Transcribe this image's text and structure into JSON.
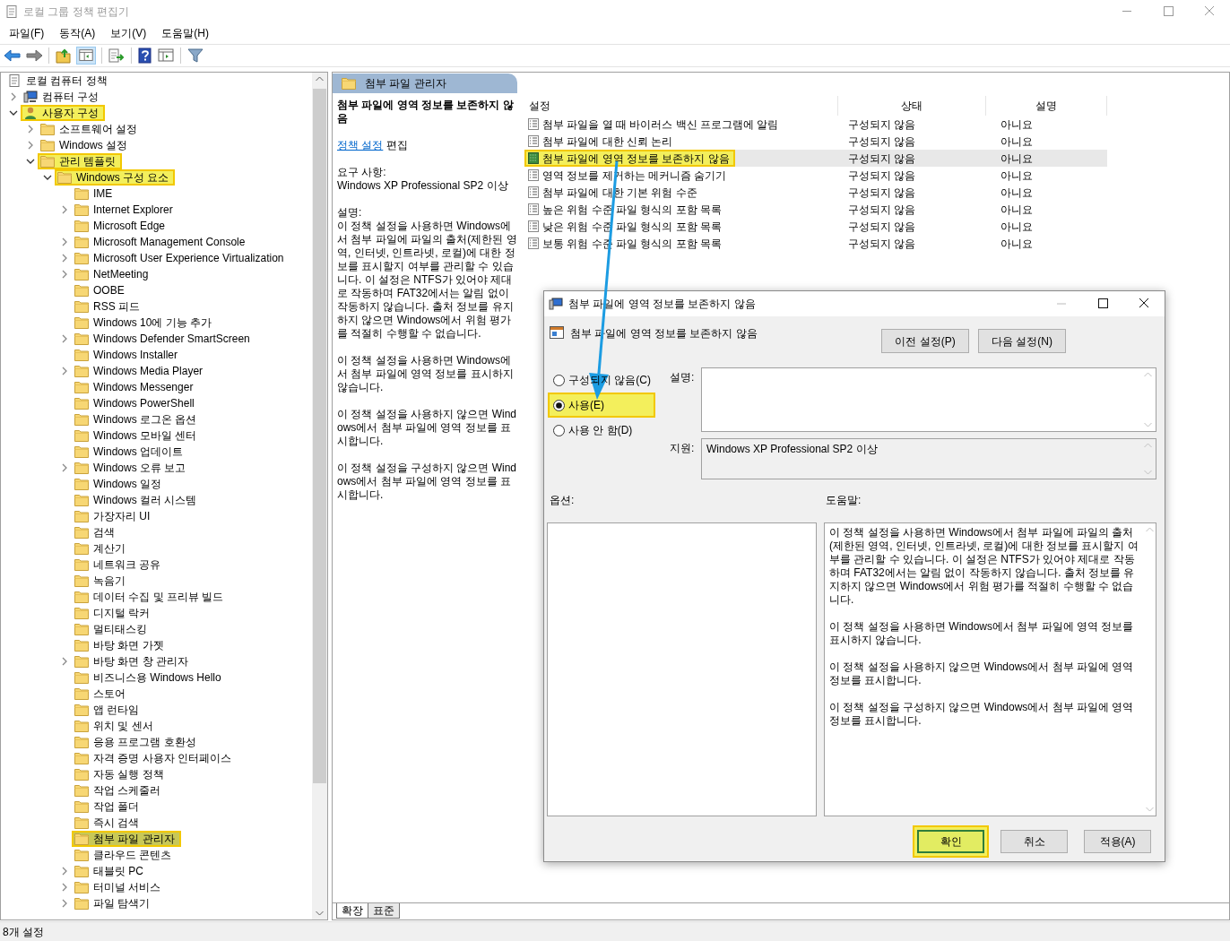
{
  "window": {
    "title": "로컬 그룹 정책 편집기",
    "active": false
  },
  "menu": [
    "파일(F)",
    "동작(A)",
    "보기(V)",
    "도움말(H)"
  ],
  "tree": {
    "root": {
      "label": "로컬 컴퓨터 정책",
      "kind": "policy",
      "selected": false,
      "highlighted": false,
      "children": [
        {
          "label": "컴퓨터 구성",
          "kind": "computer",
          "expanded": false,
          "selected": false,
          "highlighted": false
        },
        {
          "label": "사용자 구성",
          "kind": "user",
          "expanded": true,
          "selected": false,
          "highlighted": true,
          "children": [
            {
              "label": "소프트웨어 설정",
              "kind": "folder",
              "expanded": false,
              "selected": false,
              "highlighted": false
            },
            {
              "label": "Windows 설정",
              "kind": "folder",
              "expanded": false,
              "selected": false,
              "highlighted": false
            },
            {
              "label": "관리 템플릿",
              "kind": "folder",
              "expanded": true,
              "selected": false,
              "highlighted": true,
              "children": [
                {
                  "label": "Windows 구성 요소",
                  "kind": "folder",
                  "expanded": true,
                  "selected": false,
                  "highlighted": true,
                  "children": [
                    {
                      "label": "IME",
                      "kind": "folder",
                      "selected": false,
                      "highlighted": false
                    },
                    {
                      "label": "Internet Explorer",
                      "kind": "folder",
                      "expanded": false,
                      "selected": false,
                      "highlighted": false
                    },
                    {
                      "label": "Microsoft Edge",
                      "kind": "folder",
                      "selected": false,
                      "highlighted": false
                    },
                    {
                      "label": "Microsoft Management Console",
                      "kind": "folder",
                      "expanded": false,
                      "selected": false,
                      "highlighted": false
                    },
                    {
                      "label": "Microsoft User Experience Virtualization",
                      "kind": "folder",
                      "expanded": false,
                      "selected": false,
                      "highlighted": false
                    },
                    {
                      "label": "NetMeeting",
                      "kind": "folder",
                      "expanded": false,
                      "selected": false,
                      "highlighted": false
                    },
                    {
                      "label": "OOBE",
                      "kind": "folder",
                      "selected": false,
                      "highlighted": false
                    },
                    {
                      "label": "RSS 피드",
                      "kind": "folder",
                      "selected": false,
                      "highlighted": false
                    },
                    {
                      "label": "Windows 10에 기능 추가",
                      "kind": "folder",
                      "selected": false,
                      "highlighted": false
                    },
                    {
                      "label": "Windows Defender SmartScreen",
                      "kind": "folder",
                      "expanded": false,
                      "selected": false,
                      "highlighted": false
                    },
                    {
                      "label": "Windows Installer",
                      "kind": "folder",
                      "selected": false,
                      "highlighted": false
                    },
                    {
                      "label": "Windows Media Player",
                      "kind": "folder",
                      "expanded": false,
                      "selected": false,
                      "highlighted": false
                    },
                    {
                      "label": "Windows Messenger",
                      "kind": "folder",
                      "selected": false,
                      "highlighted": false
                    },
                    {
                      "label": "Windows PowerShell",
                      "kind": "folder",
                      "selected": false,
                      "highlighted": false
                    },
                    {
                      "label": "Windows 로그온 옵션",
                      "kind": "folder",
                      "selected": false,
                      "highlighted": false
                    },
                    {
                      "label": "Windows 모바일 센터",
                      "kind": "folder",
                      "selected": false,
                      "highlighted": false
                    },
                    {
                      "label": "Windows 업데이트",
                      "kind": "folder",
                      "selected": false,
                      "highlighted": false
                    },
                    {
                      "label": "Windows 오류 보고",
                      "kind": "folder",
                      "expanded": false,
                      "selected": false,
                      "highlighted": false
                    },
                    {
                      "label": "Windows 일정",
                      "kind": "folder",
                      "selected": false,
                      "highlighted": false
                    },
                    {
                      "label": "Windows 컬러 시스템",
                      "kind": "folder",
                      "selected": false,
                      "highlighted": false
                    },
                    {
                      "label": "가장자리 UI",
                      "kind": "folder",
                      "selected": false,
                      "highlighted": false
                    },
                    {
                      "label": "검색",
                      "kind": "folder",
                      "selected": false,
                      "highlighted": false
                    },
                    {
                      "label": "계산기",
                      "kind": "folder",
                      "selected": false,
                      "highlighted": false
                    },
                    {
                      "label": "네트워크 공유",
                      "kind": "folder",
                      "selected": false,
                      "highlighted": false
                    },
                    {
                      "label": "녹음기",
                      "kind": "folder",
                      "selected": false,
                      "highlighted": false
                    },
                    {
                      "label": "데이터 수집 및 프리뷰 빌드",
                      "kind": "folder",
                      "selected": false,
                      "highlighted": false
                    },
                    {
                      "label": "디지털 락커",
                      "kind": "folder",
                      "selected": false,
                      "highlighted": false
                    },
                    {
                      "label": "멀티태스킹",
                      "kind": "folder",
                      "selected": false,
                      "highlighted": false
                    },
                    {
                      "label": "바탕 화면 가젯",
                      "kind": "folder",
                      "selected": false,
                      "highlighted": false
                    },
                    {
                      "label": "바탕 화면 창 관리자",
                      "kind": "folder",
                      "expanded": false,
                      "selected": false,
                      "highlighted": false
                    },
                    {
                      "label": "비즈니스용 Windows Hello",
                      "kind": "folder",
                      "selected": false,
                      "highlighted": false
                    },
                    {
                      "label": "스토어",
                      "kind": "folder",
                      "selected": false,
                      "highlighted": false
                    },
                    {
                      "label": "앱 런타임",
                      "kind": "folder",
                      "selected": false,
                      "highlighted": false
                    },
                    {
                      "label": "위치 및 센서",
                      "kind": "folder",
                      "selected": false,
                      "highlighted": false
                    },
                    {
                      "label": "응용 프로그램 호환성",
                      "kind": "folder",
                      "selected": false,
                      "highlighted": false
                    },
                    {
                      "label": "자격 증명 사용자 인터페이스",
                      "kind": "folder",
                      "selected": false,
                      "highlighted": false
                    },
                    {
                      "label": "자동 실행 정책",
                      "kind": "folder",
                      "selected": false,
                      "highlighted": false
                    },
                    {
                      "label": "작업 스케줄러",
                      "kind": "folder",
                      "selected": false,
                      "highlighted": false
                    },
                    {
                      "label": "작업 폴더",
                      "kind": "folder",
                      "selected": false,
                      "highlighted": false
                    },
                    {
                      "label": "즉시 검색",
                      "kind": "folder",
                      "selected": false,
                      "highlighted": false
                    },
                    {
                      "label": "첨부 파일 관리자",
                      "kind": "folder",
                      "selected": true,
                      "highlighted": true
                    },
                    {
                      "label": "클라우드 콘텐츠",
                      "kind": "folder",
                      "selected": false,
                      "highlighted": false
                    },
                    {
                      "label": "태블릿 PC",
                      "kind": "folder",
                      "expanded": false,
                      "selected": false,
                      "highlighted": false
                    },
                    {
                      "label": "터미널 서비스",
                      "kind": "folder",
                      "expanded": false,
                      "selected": false,
                      "highlighted": false
                    },
                    {
                      "label": "파일 탐색기",
                      "kind": "folder",
                      "expanded": false,
                      "selected": false,
                      "highlighted": false
                    }
                  ]
                }
              ]
            }
          ]
        }
      ]
    }
  },
  "pane_header": "첨부 파일 관리자",
  "description": {
    "title": "첨부 파일에 영역 정보를 보존하지 않음",
    "edit_link": "정책 설정",
    "edit_suffix": "편집",
    "requirements_label": "요구 사항:",
    "requirements": "Windows XP Professional SP2 이상",
    "description_label": "설명:",
    "paragraphs": [
      "이 정책 설정을 사용하면 Windows에서 첨부 파일에 파일의 출처(제한된 영역, 인터넷, 인트라넷, 로컬)에 대한 정보를 표시할지 여부를 관리할 수 있습니다. 이 설정은 NTFS가 있어야 제대로 작동하며 FAT32에서는 알림 없이 작동하지 않습니다. 출처 정보를 유지하지 않으면 Windows에서 위험 평가를 적절히 수행할 수 없습니다.",
      "이 정책 설정을 사용하면 Windows에서 첨부 파일에 영역 정보를 표시하지 않습니다.",
      "이 정책 설정을 사용하지 않으면 Windows에서 첨부 파일에 영역 정보를 표시합니다.",
      "이 정책 설정을 구성하지 않으면 Windows에서 첨부 파일에 영역 정보를 표시합니다."
    ]
  },
  "settings": {
    "columns": [
      "설정",
      "상태",
      "설명"
    ],
    "rows": [
      {
        "name": "첨부 파일을 열 때 바이러스 백신 프로그램에 알림",
        "state": "구성되지 않음",
        "comment": "아니요",
        "selected": false,
        "highlighted": false
      },
      {
        "name": "첨부 파일에 대한 신뢰 논리",
        "state": "구성되지 않음",
        "comment": "아니요",
        "selected": false,
        "highlighted": false
      },
      {
        "name": "첨부 파일에 영역 정보를 보존하지 않음",
        "state": "구성되지 않음",
        "comment": "아니요",
        "selected": true,
        "highlighted": true
      },
      {
        "name": "영역 정보를 제거하는 메커니즘 숨기기",
        "state": "구성되지 않음",
        "comment": "아니요",
        "selected": false,
        "highlighted": false
      },
      {
        "name": "첨부 파일에 대한 기본 위험 수준",
        "state": "구성되지 않음",
        "comment": "아니요",
        "selected": false,
        "highlighted": false
      },
      {
        "name": "높은 위험 수준 파일 형식의 포함 목록",
        "state": "구성되지 않음",
        "comment": "아니요",
        "selected": false,
        "highlighted": false
      },
      {
        "name": "낮은 위험 수준 파일 형식의 포함 목록",
        "state": "구성되지 않음",
        "comment": "아니요",
        "selected": false,
        "highlighted": false
      },
      {
        "name": "보통 위험 수준 파일 형식의 포함 목록",
        "state": "구성되지 않음",
        "comment": "아니요",
        "selected": false,
        "highlighted": false
      }
    ]
  },
  "view_tabs": [
    {
      "label": "확장",
      "selected": true
    },
    {
      "label": "표준",
      "selected": false
    }
  ],
  "status_bar": "8개 설정",
  "dialog": {
    "title": "첨부 파일에 영역 정보를 보존하지 않음",
    "policy_name": "첨부 파일에 영역 정보를 보존하지 않음",
    "nav_buttons": [
      "이전 설정(P)",
      "다음 설정(N)"
    ],
    "options": [
      {
        "label": "구성되지 않음(C)",
        "selected": false,
        "highlighted": false
      },
      {
        "label": "사용(E)",
        "selected": true,
        "highlighted": true
      },
      {
        "label": "사용 안 함(D)",
        "selected": false,
        "highlighted": false
      }
    ],
    "comment_label": "설명:",
    "supported_label": "지원:",
    "supported": "Windows XP Professional SP2 이상",
    "options_label": "옵션:",
    "help_label": "도움말:",
    "help": [
      "이 정책 설정을 사용하면 Windows에서 첨부 파일에 파일의 출처(제한된 영역, 인터넷, 인트라넷, 로컬)에 대한 정보를 표시할지 여부를 관리할 수 있습니다. 이 설정은 NTFS가 있어야 제대로 작동하며 FAT32에서는 알림 없이 작동하지 않습니다. 출처 정보를 유지하지 않으면 Windows에서 위험 평가를 적절히 수행할 수 없습니다.",
      "이 정책 설정을 사용하면 Windows에서 첨부 파일에 영역 정보를 표시하지 않습니다.",
      "이 정책 설정을 사용하지 않으면 Windows에서 첨부 파일에 영역 정보를 표시합니다.",
      "이 정책 설정을 구성하지 않으면 Windows에서 첨부 파일에 영역 정보를 표시합니다."
    ],
    "buttons": [
      {
        "label": "확인",
        "default": true,
        "highlighted": true
      },
      {
        "label": "취소",
        "default": false,
        "highlighted": false
      },
      {
        "label": "적용(A)",
        "default": false,
        "highlighted": false
      }
    ]
  }
}
